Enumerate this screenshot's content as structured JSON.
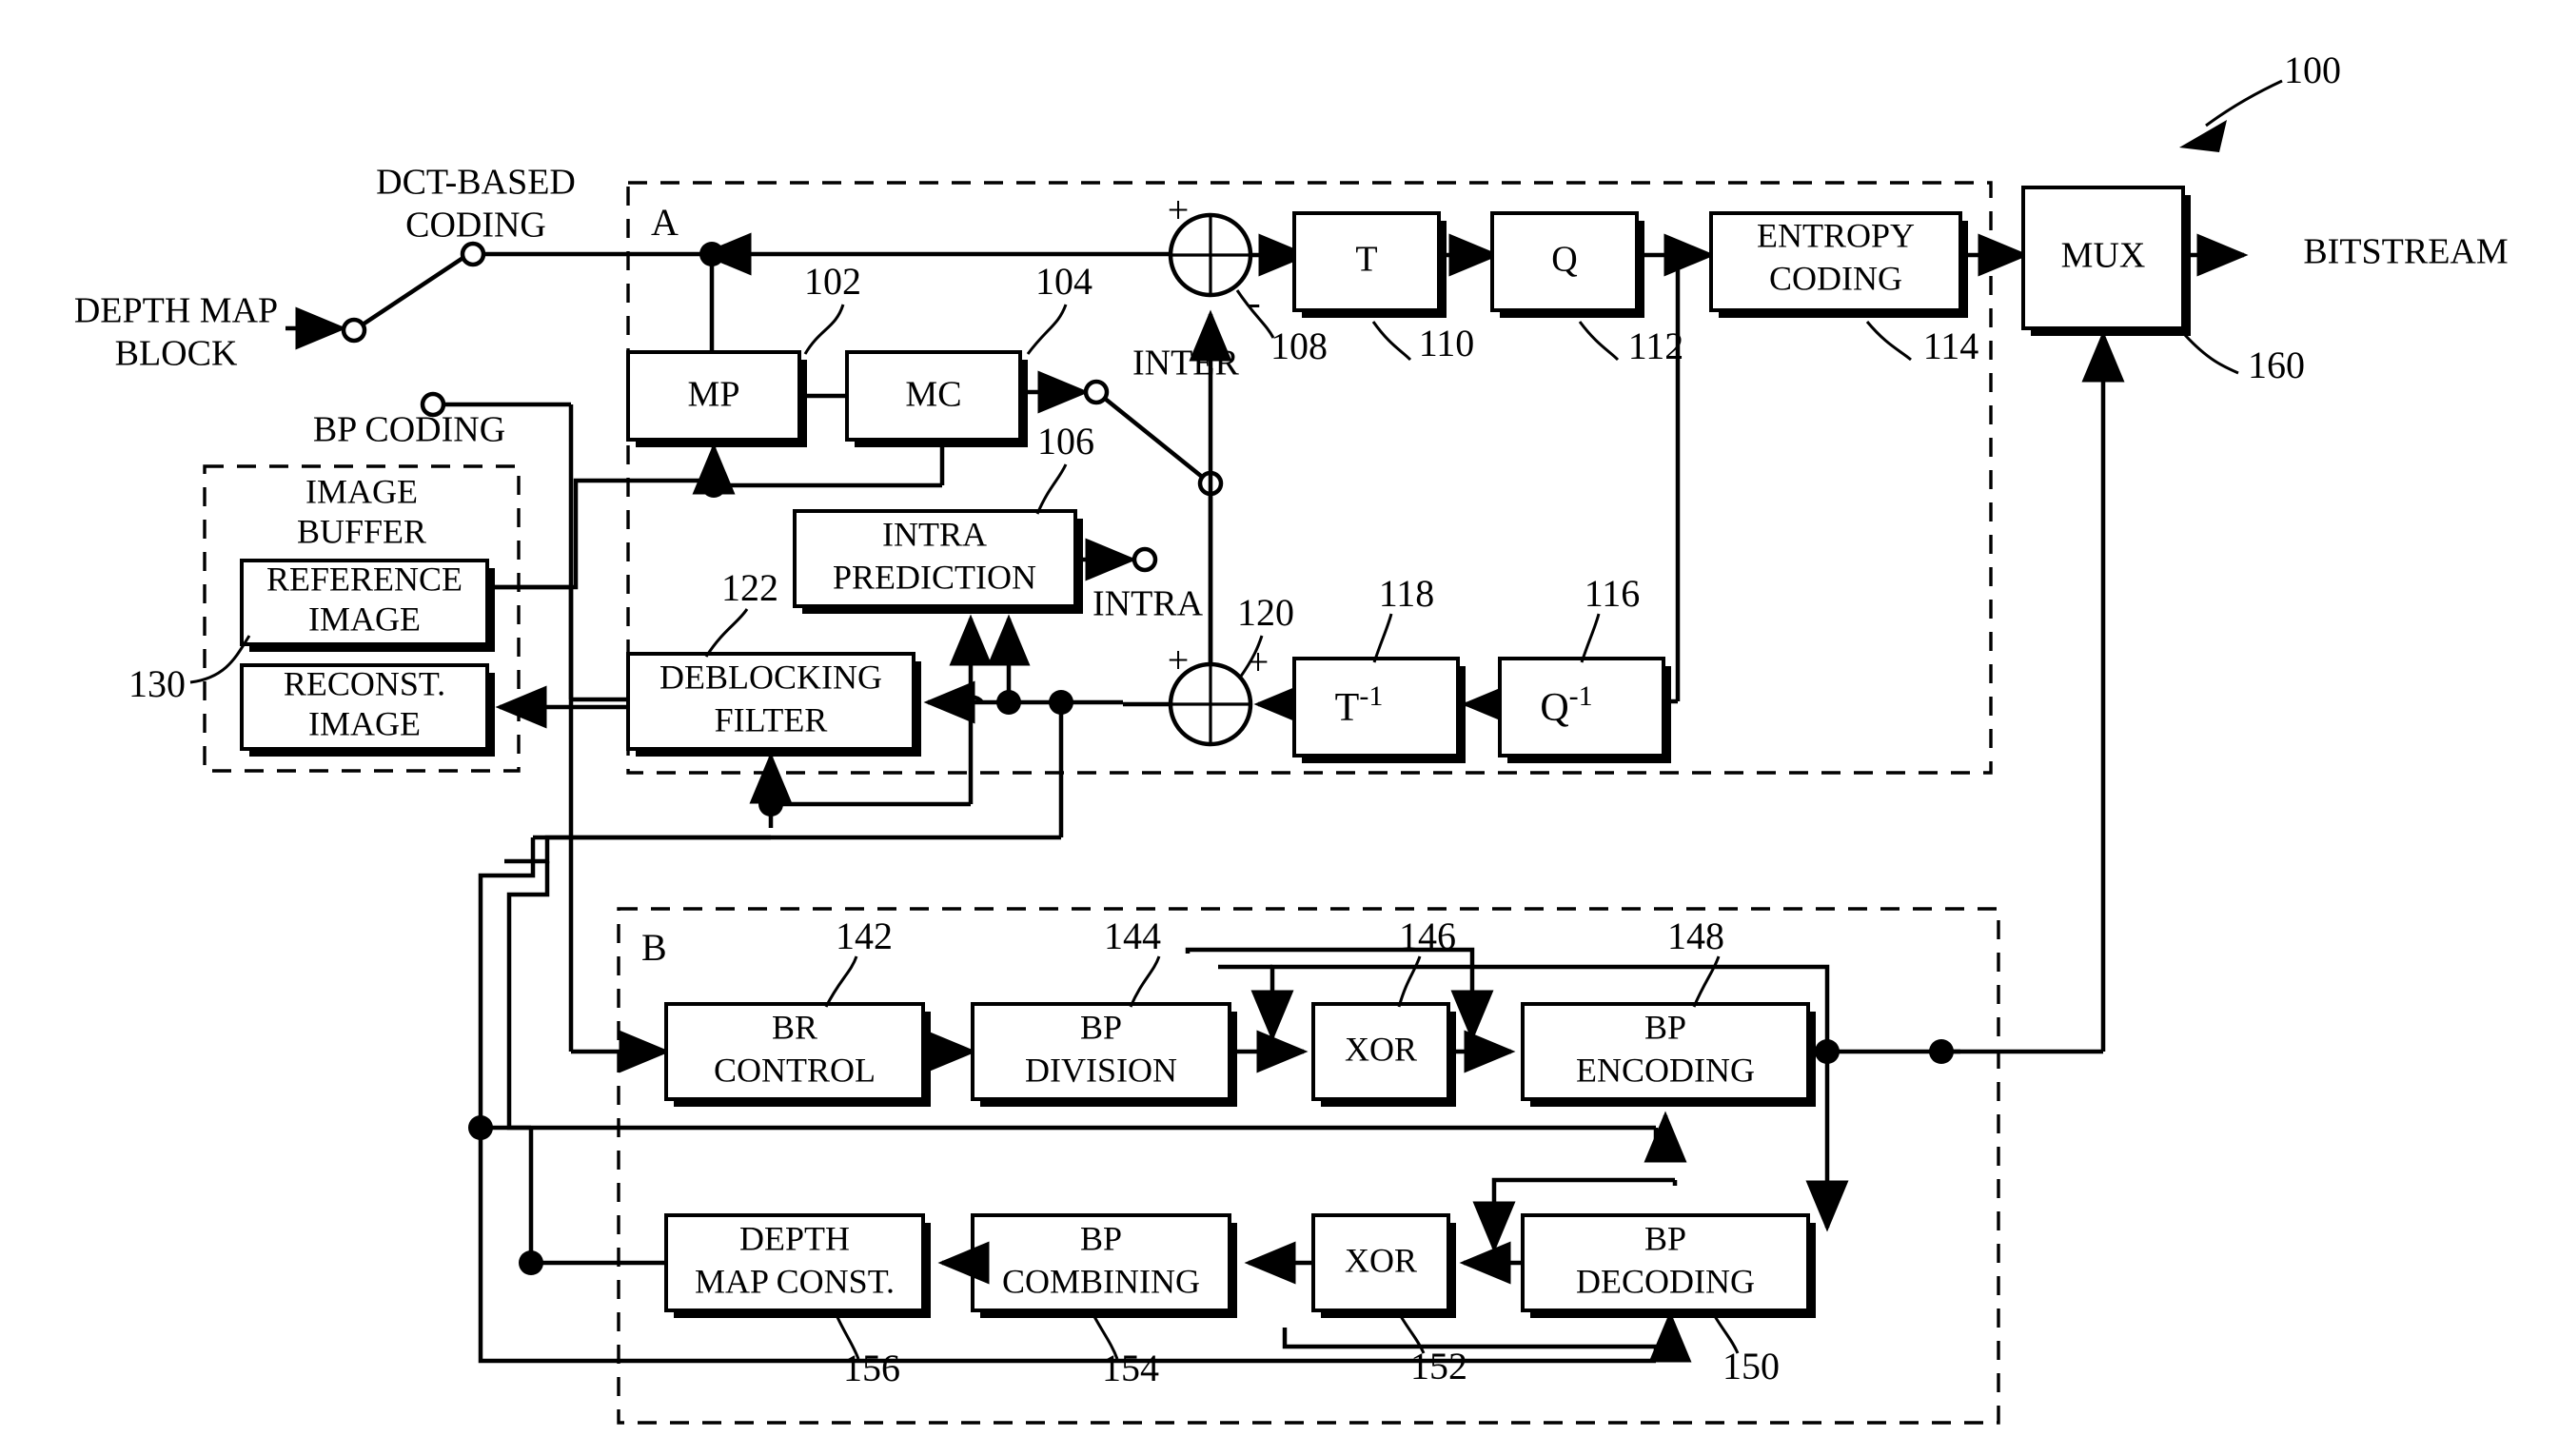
{
  "figure": {
    "id": "100",
    "mux_ref": "160",
    "buffer_ref": "130"
  },
  "inputs": {
    "depth_map_block": "DEPTH MAP\nBLOCK",
    "depth_map_block_line1": "DEPTH MAP",
    "depth_map_block_line2": "BLOCK",
    "dct_based_coding_line1": "DCT-BASED",
    "dct_based_coding_line2": "CODING",
    "bp_coding": "BP CODING"
  },
  "outputs": {
    "bitstream": "BITSTREAM"
  },
  "sections": {
    "a": "A",
    "b": "B"
  },
  "image_buffer": {
    "title_line1": "IMAGE",
    "title_line2": "BUFFER",
    "reference_line1": "REFERENCE",
    "reference_line2": "IMAGE",
    "reconst_line1": "RECONST.",
    "reconst_line2": "IMAGE",
    "ref_num": "130"
  },
  "signal_labels": {
    "inter": "INTER",
    "intra": "INTRA",
    "plus_a": "+",
    "minus_a": "-",
    "plus_b": "+",
    "plus_c": "+"
  },
  "blocks_a": [
    {
      "name": "mp",
      "label_line1": "MP",
      "label_line2": "",
      "ref": "102"
    },
    {
      "name": "mc",
      "label_line1": "MC",
      "label_line2": "",
      "ref": "104"
    },
    {
      "name": "intra-prediction",
      "label_line1": "INTRA",
      "label_line2": "PREDICTION",
      "ref": "106"
    },
    {
      "name": "adder-108",
      "label_line1": "",
      "label_line2": "",
      "ref": "108"
    },
    {
      "name": "transform",
      "label_line1": "T",
      "label_line2": "",
      "ref": "110"
    },
    {
      "name": "quantizer",
      "label_line1": "Q",
      "label_line2": "",
      "ref": "112"
    },
    {
      "name": "entropy-coding",
      "label_line1": "ENTROPY",
      "label_line2": "CODING",
      "ref": "114"
    },
    {
      "name": "inverse-quantizer",
      "label_line1": "Q",
      "label_line2": "",
      "ref": "116"
    },
    {
      "name": "inverse-transform",
      "label_line1": "T",
      "label_line2": "",
      "ref": "118"
    },
    {
      "name": "adder-120",
      "label_line1": "",
      "label_line2": "",
      "ref": "120"
    },
    {
      "name": "deblocking-filter",
      "label_line1": "DEBLOCKING",
      "label_line2": "FILTER",
      "ref": "122"
    }
  ],
  "blocks_b": [
    {
      "name": "br-control",
      "label_line1": "BR",
      "label_line2": "CONTROL",
      "ref": "142"
    },
    {
      "name": "bp-division",
      "label_line1": "BP",
      "label_line2": "DIVISION",
      "ref": "144"
    },
    {
      "name": "xor-encode",
      "label_line1": "XOR",
      "label_line2": "",
      "ref": "146"
    },
    {
      "name": "bp-encoding",
      "label_line1": "BP",
      "label_line2": "ENCODING",
      "ref": "148"
    },
    {
      "name": "bp-decoding",
      "label_line1": "BP",
      "label_line2": "DECODING",
      "ref": "150"
    },
    {
      "name": "xor-decode",
      "label_line1": "XOR",
      "label_line2": "",
      "ref": "152"
    },
    {
      "name": "bp-combining",
      "label_line1": "BP",
      "label_line2": "COMBINING",
      "ref": "154"
    },
    {
      "name": "depth-map-const",
      "label_line1": "DEPTH",
      "label_line2": "MAP CONST.",
      "ref": "156"
    }
  ],
  "mux": {
    "label": "MUX",
    "ref": "160"
  },
  "exponents": {
    "inverse": "-1"
  },
  "colors": {
    "ink": "#000000",
    "paper": "#ffffff"
  }
}
